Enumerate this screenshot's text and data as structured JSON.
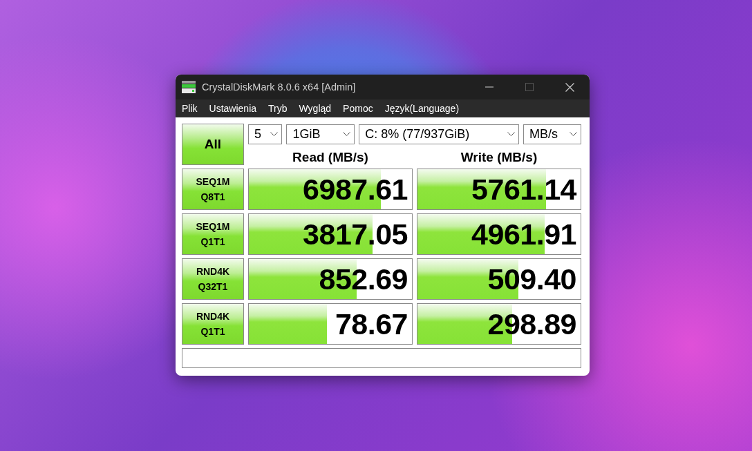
{
  "window": {
    "title": "CrystalDiskMark 8.0.6 x64 [Admin]"
  },
  "menu": [
    "Plik",
    "Ustawienia",
    "Tryb",
    "Wygląd",
    "Pomoc",
    "Język(Language)"
  ],
  "all_button": {
    "label": "All"
  },
  "selectors": [
    {
      "value": "5"
    },
    {
      "value": "1GiB"
    },
    {
      "value": "C: 8% (77/937GiB)"
    },
    {
      "value": "MB/s"
    }
  ],
  "columns": [
    "Read (MB/s)",
    "Write (MB/s)"
  ],
  "tests": [
    {
      "label_line_1": "SEQ1M",
      "label_line_2": "Q8T1",
      "read": {
        "value": "6987.61",
        "level": 0.81
      },
      "write": {
        "value": "5761.14",
        "level": 0.79
      }
    },
    {
      "label_line_1": "SEQ1M",
      "label_line_2": "Q1T1",
      "read": {
        "value": "3817.05",
        "level": 0.76
      },
      "write": {
        "value": "4961.91",
        "level": 0.78
      }
    },
    {
      "label_line_1": "RND4K",
      "label_line_2": "Q32T1",
      "read": {
        "value": "852.69",
        "level": 0.66
      },
      "write": {
        "value": "509.40",
        "level": 0.62
      }
    },
    {
      "label_line_1": "RND4K",
      "label_line_2": "Q1T1",
      "read": {
        "value": "78.67",
        "level": 0.48
      },
      "write": {
        "value": "298.89",
        "level": 0.58
      }
    }
  ]
}
